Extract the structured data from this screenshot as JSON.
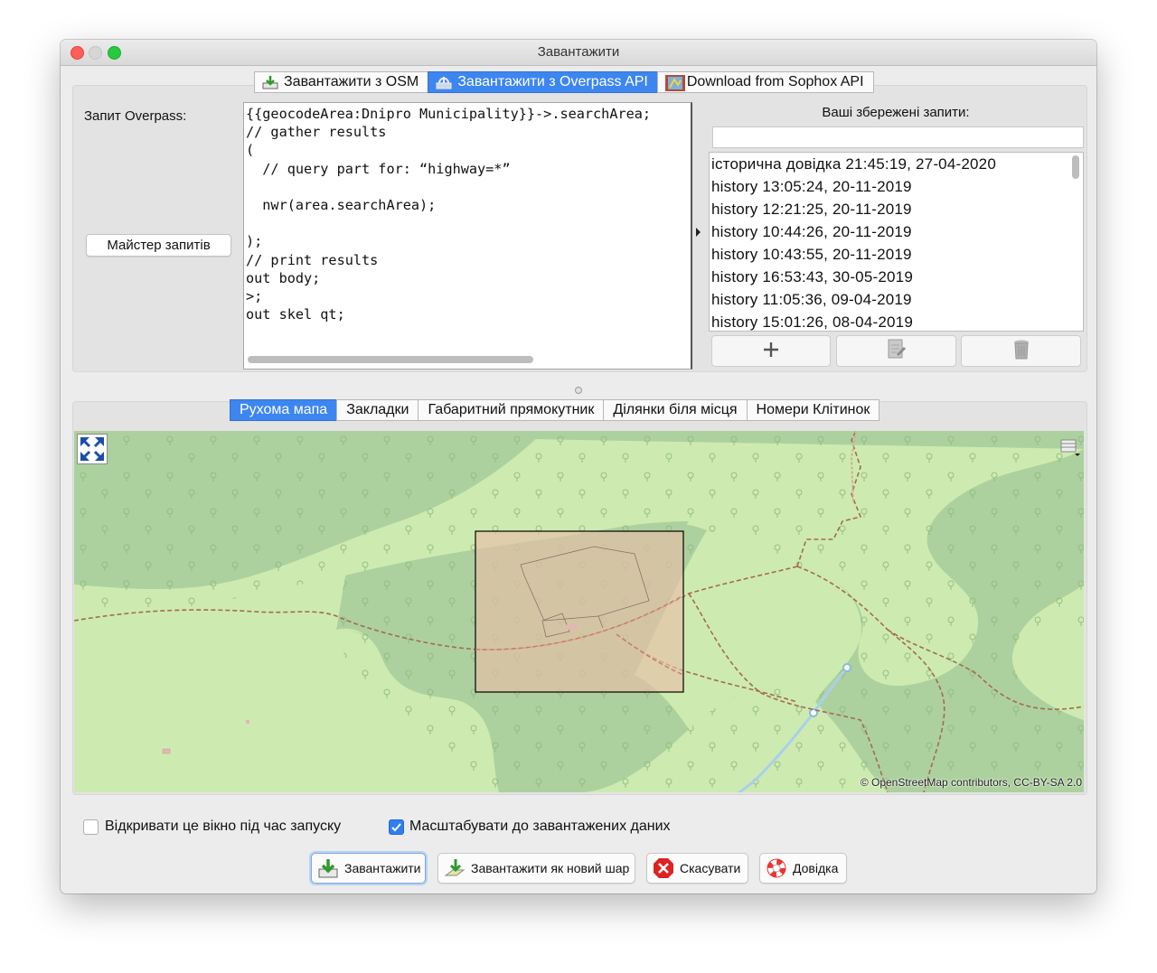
{
  "window": {
    "title": "Завантажити"
  },
  "source_tabs": [
    {
      "label": "Завантажити з OSM",
      "icon": "download-icon",
      "selected": false
    },
    {
      "label": "Завантажити з Overpass API",
      "icon": "overpass-icon",
      "selected": true
    },
    {
      "label": "Download from Sophox API",
      "icon": "sophox-icon",
      "selected": false
    }
  ],
  "query": {
    "label": "Запит Overpass:",
    "wizard_button": "Майстер запитів",
    "text": "{{geocodeArea:Dnipro Municipality}}->.searchArea;\n// gather results\n(\n  // query part for: “highway=*”\n\n  nwr(area.searchArea);\n\n);\n// print results\nout body;\n>;\nout skel qt;"
  },
  "saved": {
    "title": "Ваші збережені запити:",
    "search_value": "",
    "items": [
      "історична довідка 21:45:19, 27-04-2020",
      "history 13:05:24, 20-11-2019",
      "history 12:21:25, 20-11-2019",
      "history 10:44:26, 20-11-2019",
      "history 10:43:55, 20-11-2019",
      "history 16:53:43, 30-05-2019",
      "history 11:05:36, 09-04-2019",
      "history 15:01:26, 08-04-2019"
    ]
  },
  "map_tabs": [
    {
      "label": "Рухома мапа",
      "selected": true
    },
    {
      "label": "Закладки",
      "selected": false
    },
    {
      "label": "Габаритний прямокутник",
      "selected": false
    },
    {
      "label": "Ділянки біля місця",
      "selected": false
    },
    {
      "label": "Номери Клітинок",
      "selected": false
    }
  ],
  "map": {
    "attribution": "© OpenStreetMap contributors, CC-BY-SA 2.0",
    "colors": {
      "forest": "#add19e",
      "meadow": "#cdebb0",
      "selection": "#d9c5b2",
      "track": "#a56a52",
      "stream": "#a8d0ec"
    }
  },
  "options": [
    {
      "label": "Відкривати це вікно під час запуску",
      "checked": false
    },
    {
      "label": "Масштабувати до завантажених даних",
      "checked": true
    }
  ],
  "buttons": {
    "download": "Завантажити",
    "download_new_layer": "Завантажити як новий шар",
    "cancel": "Скасувати",
    "help": "Довідка"
  }
}
